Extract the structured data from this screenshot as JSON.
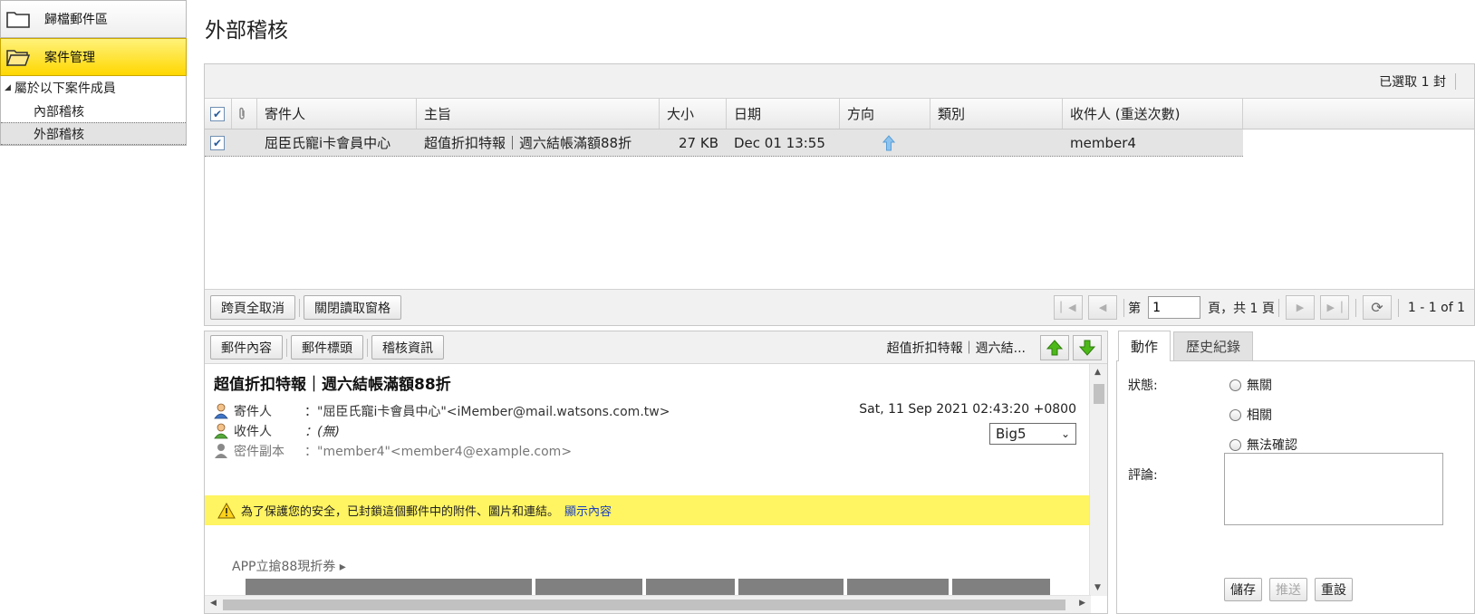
{
  "sidebar": {
    "sections": [
      {
        "label": "歸檔郵件區",
        "active": false
      },
      {
        "label": "案件管理",
        "active": true
      }
    ],
    "tree": {
      "root_label": "屬於以下案件成員",
      "items": [
        {
          "label": "內部稽核",
          "selected": false
        },
        {
          "label": "外部稽核",
          "selected": true
        }
      ]
    }
  },
  "page": {
    "title": "外部稽核"
  },
  "list": {
    "selected_count_text": "已選取 1 封",
    "columns": {
      "from": "寄件人",
      "subject": "主旨",
      "size": "大小",
      "date": "日期",
      "direction": "方向",
      "category": "類別",
      "recipients": "收件人 (重送次數)"
    },
    "rows": [
      {
        "checked": true,
        "from": "屈臣氏寵i卡會員中心",
        "subject": "超值折扣特報｜週六結帳滿額88折",
        "size": "27 KB",
        "date": "Dec 01 13:55",
        "direction_icon": "arrow-up-icon",
        "category": "",
        "recipients": "member4"
      }
    ],
    "footer": {
      "deselect_all_label": "跨頁全取消",
      "close_reading_pane_label": "關閉讀取窗格"
    },
    "pager": {
      "page_prefix": "第",
      "page_value": "1",
      "page_suffix": "頁，共 1 頁",
      "range_text": "1 - 1 of 1"
    }
  },
  "preview": {
    "toolbar": {
      "content_tab": "郵件內容",
      "header_tab": "郵件標頭",
      "audit_tab": "稽核資訊",
      "subject_short": "超值折扣特報｜週六結..."
    },
    "message": {
      "subject": "超值折扣特報｜週六結帳滿額88折",
      "from_label": "寄件人",
      "from_value": "：\"屈臣氏寵i卡會員中心\"<iMember@mail.watsons.com.tw>",
      "to_label": "收件人",
      "to_value": "：(無)",
      "cc_label": "密件副本",
      "cc_value": "：\"member4\"<member4@example.com>",
      "date": "Sat, 11 Sep 2021 02:43:20 +0800",
      "charset": "Big5"
    },
    "warning": {
      "text": "為了保護您的安全，已封鎖這個郵件中的附件、圖片和連結。",
      "link": "顯示內容"
    },
    "body": {
      "promo_text": "APP立搶88現折券 ▸"
    }
  },
  "actions": {
    "tabs": [
      {
        "label": "動作",
        "active": true
      },
      {
        "label": "歷史紀錄",
        "active": false
      }
    ],
    "status_label": "狀態:",
    "status_options": [
      "無關",
      "相關",
      "無法確認"
    ],
    "comment_label": "評論:",
    "buttons": {
      "save": "儲存",
      "push": "推送",
      "reset": "重設"
    }
  },
  "colors": {
    "active_section": "#ffd700",
    "warning_bg": "#fff461",
    "link": "#1a3fbf",
    "direction_arrow": "#7fb7e6",
    "nav_arrow_green": "#3ca10f"
  }
}
